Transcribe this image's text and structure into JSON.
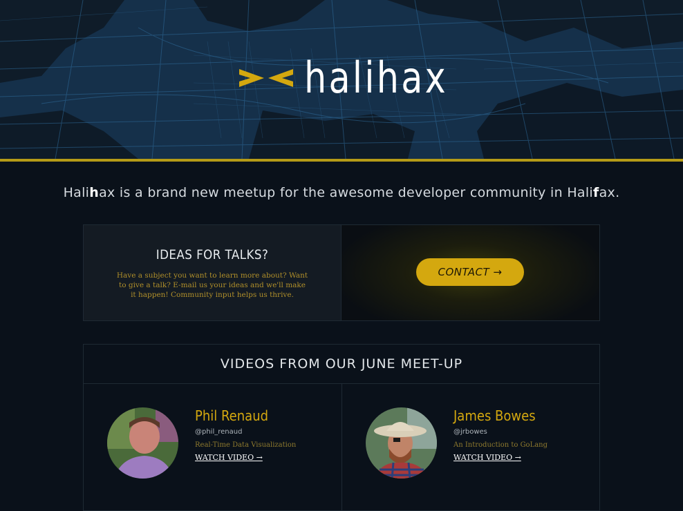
{
  "brand": {
    "name": "halihax",
    "accent": "#d4a80f"
  },
  "tagline": {
    "part1": "Hali",
    "bold1": "h",
    "part2": "ax is a brand new meetup for the awesome developer community in Hali",
    "bold2": "f",
    "part3": "ax."
  },
  "talks": {
    "title": "IDEAS FOR TALKS?",
    "body": "Have a subject you want to learn more about? Want to give a talk? E-mail us your ideas and we'll make it happen! Community input helps us thrive.",
    "contact_label": "CONTACT →"
  },
  "videos": {
    "title": "VIDEOS FROM OUR JUNE MEET-UP",
    "speakers": [
      {
        "name": "Phil Renaud",
        "handle": "@phil_renaud",
        "topic": "Real-Time Data Visualization",
        "link": "WATCH VIDEO →"
      },
      {
        "name": "James Bowes",
        "handle": "@jrbowes",
        "topic": "An Introduction to GoLang",
        "link": "WATCH VIDEO →"
      }
    ]
  }
}
